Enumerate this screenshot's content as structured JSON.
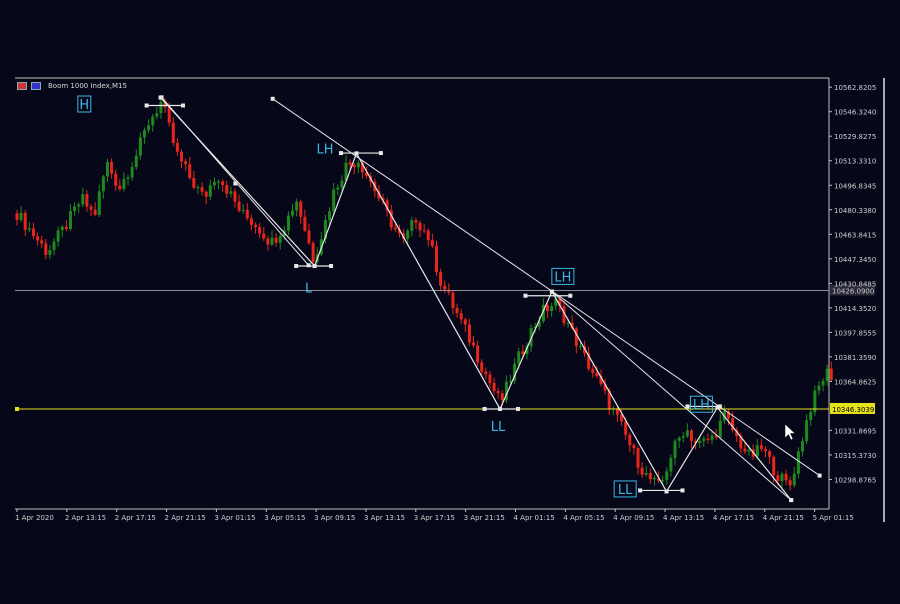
{
  "window": {
    "symbol_title": "Boom 1000 Index,M15"
  },
  "colors": {
    "background": "#07071a",
    "bull_candle": "#1e8a1e",
    "bear_candle": "#e8261a",
    "structure_line": "#e8e8e8",
    "structure_label": "#3ab7e3",
    "current_price_line": "#e6e21a",
    "reference_line": "#8e8e9a",
    "axis_text": "#cfcfcf"
  },
  "chart_data": {
    "type": "candlestick",
    "title": "Boom 1000 Index,M15",
    "x_ticks": [
      "1 Apr 2020",
      "2 Apr 13:15",
      "2 Apr 17:15",
      "2 Apr 21:15",
      "3 Apr 01:15",
      "3 Apr 05:15",
      "3 Apr 09:15",
      "3 Apr 13:15",
      "3 Apr 17:15",
      "3 Apr 21:15",
      "4 Apr 01:15",
      "4 Apr 05:15",
      "4 Apr 09:15",
      "4 Apr 13:15",
      "4 Apr 17:15",
      "4 Apr 21:15",
      "5 Apr 01:15"
    ],
    "y_ticks": [
      "10562.8205",
      "10546.3240",
      "10529.8275",
      "10513.3310",
      "10496.8345",
      "10480.3380",
      "10463.8415",
      "10447.3450",
      "10430.8485",
      "10414.3520",
      "10397.8555",
      "10381.3590",
      "10364.8625",
      "10331.8695",
      "10315.3730",
      "10298.8765"
    ],
    "y_tick_values": [
      10562.8205,
      10546.324,
      10529.8275,
      10513.331,
      10496.8345,
      10480.338,
      10463.8415,
      10447.345,
      10430.8485,
      10414.352,
      10397.8555,
      10381.359,
      10364.8625,
      10331.8695,
      10315.373,
      10298.8765
    ],
    "ylim": [
      10279.0,
      10569.0
    ],
    "grid": false,
    "price_lines": [
      {
        "name": "current-price",
        "value": 10346.3039,
        "label": "10346.3039"
      },
      {
        "name": "reference-level",
        "value": 10426.0,
        "label": "10426.0900"
      }
    ],
    "swing_labels": [
      {
        "text": "H",
        "x": 1.35,
        "price": 10551.5,
        "boxed": true
      },
      {
        "text": "LH",
        "x": 6.18,
        "price": 10521.5,
        "boxed": false
      },
      {
        "text": "L",
        "x": 5.85,
        "price": 10428.0,
        "boxed": false
      },
      {
        "text": "LH",
        "x": 10.95,
        "price": 10435.5,
        "boxed": true
      },
      {
        "text": "LL",
        "x": 9.65,
        "price": 10335.0,
        "boxed": false
      },
      {
        "text": "LH",
        "x": 13.73,
        "price": 10349.5,
        "boxed": true
      },
      {
        "text": "LL",
        "x": 12.2,
        "price": 10292.5,
        "boxed": true
      }
    ],
    "zigzag": [
      {
        "x": 2.88,
        "price": 10555.8
      },
      {
        "x": 5.97,
        "price": 10442.5
      },
      {
        "x": 6.81,
        "price": 10518.3
      },
      {
        "x": 9.69,
        "price": 10346.3
      },
      {
        "x": 10.73,
        "price": 10425.3
      },
      {
        "x": 13.03,
        "price": 10290.8
      },
      {
        "x": 14.05,
        "price": 10347.3
      },
      {
        "x": 15.53,
        "price": 10285.0
      }
    ],
    "trendlines": [
      {
        "from": {
          "x": 2.9,
          "price": 10556.0
        },
        "to": {
          "x": 5.85,
          "price": 10443.0
        },
        "mid": {
          "x": 4.38,
          "price": 10498.0
        }
      },
      {
        "from": {
          "x": 5.13,
          "price": 10555.0
        },
        "to": {
          "x": 16.1,
          "price": 10301.5
        }
      },
      {
        "from": {
          "x": 10.73,
          "price": 10425.3
        },
        "to": {
          "x": 15.53,
          "price": 10285.0
        }
      }
    ],
    "swing_bars": [
      {
        "x1": 2.6,
        "x2": 3.33,
        "price": 10550.5
      },
      {
        "x1": 5.6,
        "x2": 6.3,
        "price": 10442.5
      },
      {
        "x1": 6.5,
        "x2": 7.3,
        "price": 10518.5
      },
      {
        "x1": 9.38,
        "x2": 10.05,
        "price": 10346.3
      },
      {
        "x1": 10.2,
        "x2": 11.1,
        "price": 10422.5
      },
      {
        "x1": 12.5,
        "x2": 13.35,
        "price": 10291.5
      },
      {
        "x1": 13.45,
        "x2": 14.1,
        "price": 10348.0
      }
    ],
    "series": [
      {
        "name": "price",
        "path": [
          [
            0,
            10478
          ],
          [
            0.6,
            10452
          ],
          [
            0.95,
            10468
          ],
          [
            1.3,
            10488
          ],
          [
            1.55,
            10476
          ],
          [
            1.8,
            10512
          ],
          [
            2.05,
            10495
          ],
          [
            2.4,
            10518
          ],
          [
            2.65,
            10540
          ],
          [
            2.9,
            10553
          ],
          [
            3.2,
            10518
          ],
          [
            3.5,
            10500
          ],
          [
            3.75,
            10488
          ],
          [
            4.0,
            10505
          ],
          [
            4.2,
            10495
          ],
          [
            4.5,
            10478
          ],
          [
            4.8,
            10470
          ],
          [
            5.1,
            10458
          ],
          [
            5.4,
            10472
          ],
          [
            5.6,
            10488
          ],
          [
            5.95,
            10447
          ],
          [
            6.15,
            10468
          ],
          [
            6.35,
            10492
          ],
          [
            6.6,
            10510
          ],
          [
            6.85,
            10514
          ],
          [
            7.15,
            10496
          ],
          [
            7.5,
            10472
          ],
          [
            7.75,
            10458
          ],
          [
            8.0,
            10475
          ],
          [
            8.25,
            10462
          ],
          [
            8.5,
            10432
          ],
          [
            8.8,
            10412
          ],
          [
            9.1,
            10392
          ],
          [
            9.4,
            10370
          ],
          [
            9.7,
            10350
          ],
          [
            10.0,
            10376
          ],
          [
            10.3,
            10398
          ],
          [
            10.55,
            10412
          ],
          [
            10.8,
            10418
          ],
          [
            11.05,
            10404
          ],
          [
            11.3,
            10386
          ],
          [
            11.6,
            10368
          ],
          [
            11.85,
            10352
          ],
          [
            12.1,
            10336
          ],
          [
            12.35,
            10318
          ],
          [
            12.6,
            10302
          ],
          [
            12.9,
            10293
          ],
          [
            13.15,
            10318
          ],
          [
            13.4,
            10334
          ],
          [
            13.65,
            10322
          ],
          [
            13.95,
            10327
          ],
          [
            14.2,
            10342
          ],
          [
            14.45,
            10326
          ],
          [
            14.7,
            10314
          ],
          [
            14.95,
            10320
          ],
          [
            15.25,
            10302
          ],
          [
            15.5,
            10294
          ],
          [
            15.7,
            10320
          ],
          [
            15.9,
            10346
          ],
          [
            16.15,
            10366
          ],
          [
            16.3,
            10373
          ],
          [
            16.4,
            10362
          ]
        ]
      }
    ]
  }
}
